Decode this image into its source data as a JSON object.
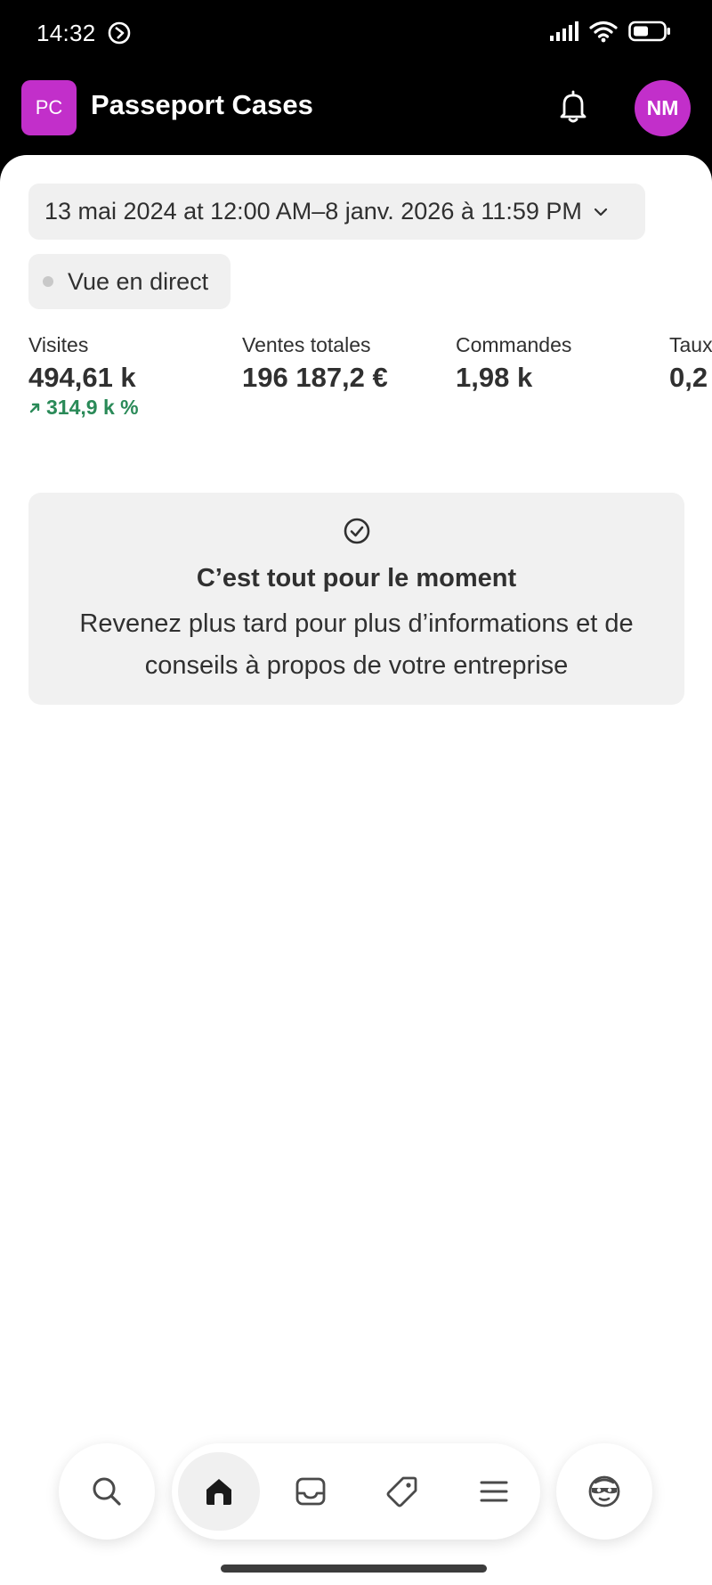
{
  "status_bar": {
    "time": "14:32"
  },
  "header": {
    "store_initials": "PC",
    "store_name": "Passeport Cases",
    "user_initials": "NM",
    "accent_color": "#c22fca"
  },
  "filters": {
    "date_range": "13 mai 2024 at 12:00 AM–8 janv. 2026 à 11:59 PM",
    "live_view": "Vue en direct"
  },
  "metrics": [
    {
      "label": "Visites",
      "value": "494,61 k",
      "trend": "314,9 k %"
    },
    {
      "label": "Ventes totales",
      "value": "196 187,2 €"
    },
    {
      "label": "Commandes",
      "value": "1,98 k"
    },
    {
      "label": "Taux",
      "value": "0,2"
    }
  ],
  "info_card": {
    "title": "C’est tout pour le moment",
    "body": "Revenez plus tard pour plus d’informations et de conseils à propos de votre entreprise"
  },
  "nav": {
    "items": [
      "search-icon",
      "home-icon",
      "inbox-icon",
      "tag-icon",
      "menu-icon",
      "sidekick-icon"
    ],
    "active": "home-icon"
  },
  "colors": {
    "trend_positive": "#2a8a58"
  }
}
